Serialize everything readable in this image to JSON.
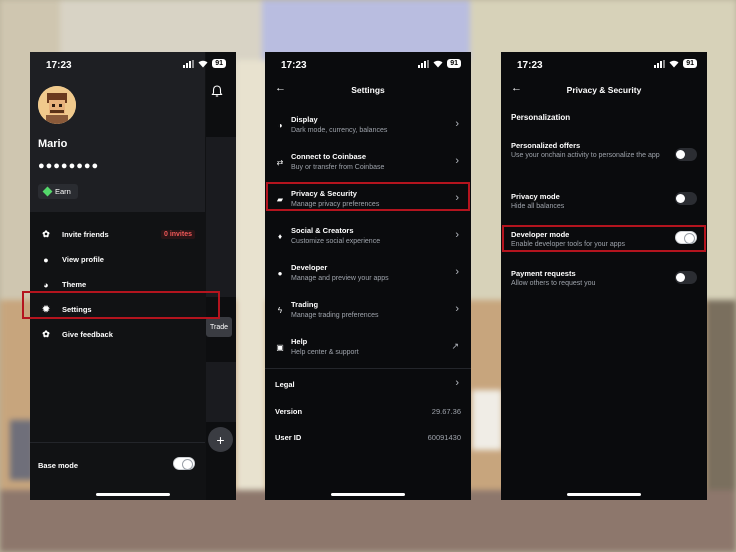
{
  "status_bar": {
    "time": "17:23",
    "battery": "91"
  },
  "drawer": {
    "user_name": "Mario",
    "masked_balance": "●●●●●●●●",
    "earn_label": "Earn",
    "menu": [
      {
        "label": "Invite friends",
        "icon": "gift-icon",
        "badge": "0 invites"
      },
      {
        "label": "View profile",
        "icon": "person-icon"
      },
      {
        "label": "Theme",
        "icon": "palette-icon"
      },
      {
        "label": "Settings",
        "icon": "gear-icon"
      },
      {
        "label": "Give feedback",
        "icon": "feedback-icon"
      }
    ],
    "base_mode_label": "Base mode",
    "base_mode_on": true,
    "underlay_trade": "Trade",
    "underlay_fab": "+"
  },
  "settings": {
    "title": "Settings",
    "rows": [
      {
        "title": "Display",
        "subtitle": "Dark mode, currency, balances",
        "icon": "display-icon"
      },
      {
        "title": "Connect to Coinbase",
        "subtitle": "Buy or transfer from Coinbase",
        "icon": "transfer-icon"
      },
      {
        "title": "Privacy & Security",
        "subtitle": "Manage privacy preferences",
        "icon": "lock-icon"
      },
      {
        "title": "Social & Creators",
        "subtitle": "Customize social experience",
        "icon": "bell-icon"
      },
      {
        "title": "Developer",
        "subtitle": "Manage and preview your apps",
        "icon": "globe-icon"
      },
      {
        "title": "Trading",
        "subtitle": "Manage trading preferences",
        "icon": "bolt-icon"
      },
      {
        "title": "Help",
        "subtitle": "Help center & support",
        "icon": "help-icon"
      }
    ],
    "legal_label": "Legal",
    "version_label": "Version",
    "version_value": "29.67.36",
    "user_id_label": "User ID",
    "user_id_value": "60091430"
  },
  "privacy": {
    "title": "Privacy & Security",
    "section": "Personalization",
    "rows": [
      {
        "title": "Personalized offers",
        "subtitle": "Use your onchain activity to personalize the app",
        "on": false
      },
      {
        "title": "Privacy mode",
        "subtitle": "Hide all balances",
        "on": false
      },
      {
        "title": "Developer mode",
        "subtitle": "Enable developer tools for your apps",
        "on": true
      },
      {
        "title": "Payment requests",
        "subtitle": "Allow others to request you",
        "on": false
      }
    ]
  },
  "colors": {
    "highlight": "#b4141e",
    "background": "#0a0b0d",
    "badge_red": "#f25858",
    "earn_green": "#54d86b"
  }
}
